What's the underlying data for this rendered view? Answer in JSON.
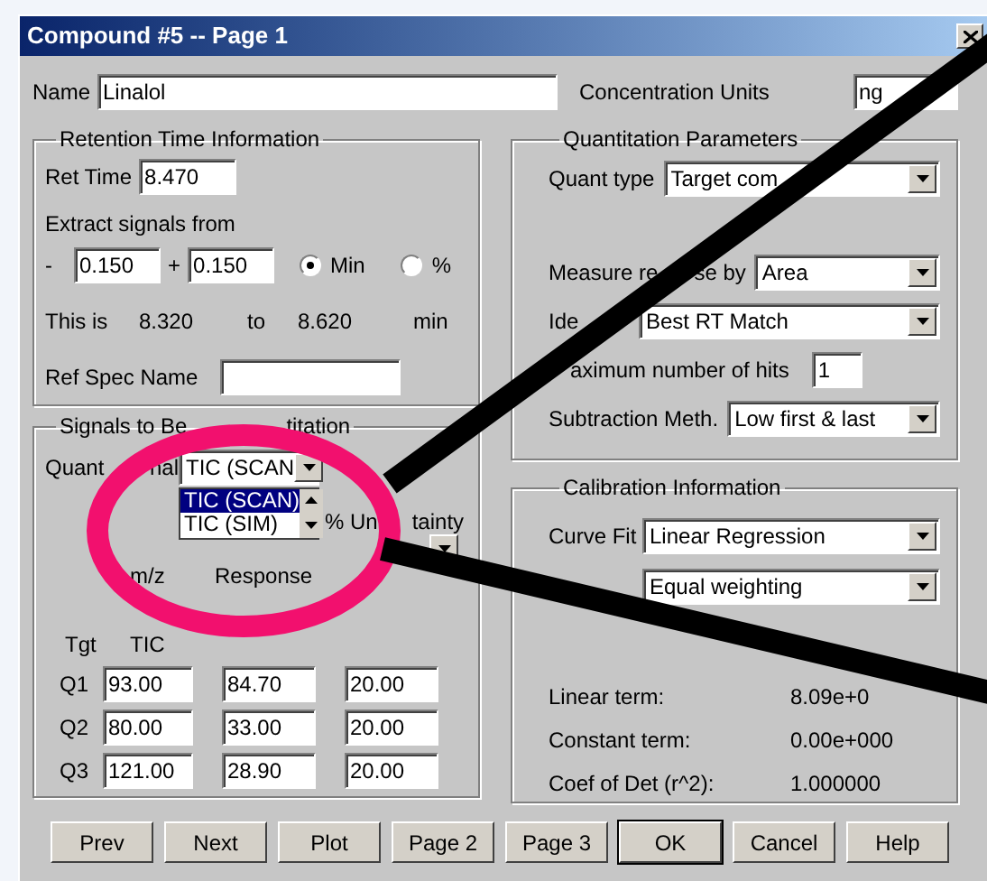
{
  "window": {
    "title": "Compound #5 -- Page 1"
  },
  "name": {
    "label": "Name",
    "value": "Linalol"
  },
  "concentration_units": {
    "label": "Concentration Units",
    "value": "ng"
  },
  "retention": {
    "title": "Retention Time Information",
    "ret_time": {
      "label": "Ret Time",
      "value": "8.470"
    },
    "extract_label": "Extract signals from",
    "minus_sign": "-",
    "minus_value": "0.150",
    "plus_sign": "+",
    "plus_value": "0.150",
    "units": [
      {
        "label": "Min",
        "selected": true
      },
      {
        "label": "%",
        "selected": false
      }
    ],
    "range": [
      "This is",
      "8.320",
      "to",
      "8.620",
      "min"
    ],
    "ref_spec_label": "Ref Spec Name"
  },
  "signals": {
    "title_parts": [
      "Signals to Be",
      "titation"
    ],
    "quant_signal": {
      "label_parts": [
        "Quant",
        "nal"
      ],
      "value": "TIC (SCAN"
    },
    "options": [
      {
        "label": "TIC (SCAN)",
        "selected": true
      },
      {
        "label": "TIC (SIM)",
        "selected": false
      }
    ],
    "uncertainty_parts": [
      "% Un",
      "tainty"
    ],
    "headers": [
      "m/z",
      "Response"
    ],
    "row_header": [
      "Tgt",
      "TIC"
    ],
    "rows": [
      {
        "label": "Q1",
        "values": [
          "93.00",
          "84.70",
          "20.00"
        ]
      },
      {
        "label": "Q2",
        "values": [
          "80.00",
          "33.00",
          "20.00"
        ]
      },
      {
        "label": "Q3",
        "values": [
          "121.00",
          "28.90",
          "20.00"
        ]
      }
    ]
  },
  "quantitation": {
    "title": "Quantitation Parameters",
    "fields": [
      {
        "kind": "select",
        "label_parts": [
          "Quant type"
        ],
        "value": "Target com"
      },
      {
        "kind": "select",
        "label_parts": [
          "Measure re",
          "se by"
        ],
        "value": "Area"
      },
      {
        "kind": "select",
        "label_parts": [
          "Ide"
        ],
        "value": "Best RT Match"
      },
      {
        "kind": "input",
        "label_parts": [
          "aximum number of hits"
        ],
        "value": "1"
      },
      {
        "kind": "select",
        "label_parts": [
          "Subtraction Meth."
        ],
        "value": "Low first & last"
      }
    ]
  },
  "calibration": {
    "title": "Calibration Information",
    "fields": [
      {
        "label": "Curve Fit",
        "value": "Linear Regression"
      },
      {
        "value": "Equal weighting"
      }
    ],
    "terms": [
      {
        "label": "Linear term:",
        "value": "8.09e+0"
      },
      {
        "label": "Constant term:",
        "value": "0.00e+000"
      },
      {
        "label": "Coef of Det (r^2):",
        "value": "1.000000"
      }
    ]
  },
  "buttons": [
    {
      "label": "Prev",
      "default": false
    },
    {
      "label": "Next",
      "default": false
    },
    {
      "label": "Plot",
      "default": false
    },
    {
      "label": "Page 2",
      "default": false
    },
    {
      "label": "Page 3",
      "default": false
    },
    {
      "label": "OK",
      "default": true
    },
    {
      "label": "Cancel",
      "default": false
    },
    {
      "label": "Help",
      "default": false
    }
  ]
}
